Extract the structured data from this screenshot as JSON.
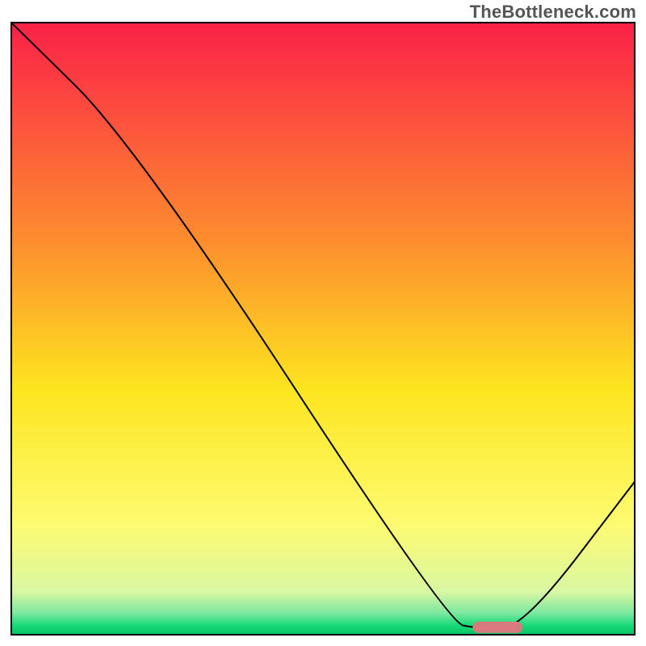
{
  "watermark": "TheBottleneck.com",
  "chart_data": {
    "type": "line",
    "title": "",
    "xlabel": "",
    "ylabel": "",
    "xlim": [
      0,
      100
    ],
    "ylim": [
      0,
      100
    ],
    "grid": false,
    "legend": false,
    "series": [
      {
        "name": "bottleneck-curve",
        "x": [
          0,
          20,
          70,
          75,
          82,
          100
        ],
        "y": [
          100,
          80,
          2,
          1,
          1,
          25
        ],
        "stroke": "#000000",
        "stroke_width": 2
      }
    ],
    "marker": {
      "name": "optimal-zone",
      "x_start": 74,
      "x_end": 82,
      "y": 1.2,
      "color": "#d97a7e",
      "shape": "pill"
    },
    "background_gradient": {
      "stops": [
        {
          "offset": 0.0,
          "color": "#fb2148"
        },
        {
          "offset": 0.35,
          "color": "#fd8b2f"
        },
        {
          "offset": 0.6,
          "color": "#fde51f"
        },
        {
          "offset": 0.82,
          "color": "#fdfb71"
        },
        {
          "offset": 0.93,
          "color": "#d9f7a2"
        },
        {
          "offset": 0.965,
          "color": "#7be8a0"
        },
        {
          "offset": 0.985,
          "color": "#17d977"
        },
        {
          "offset": 1.0,
          "color": "#06c466"
        }
      ]
    },
    "frame": {
      "stroke": "#000000",
      "stroke_width": 2
    }
  }
}
